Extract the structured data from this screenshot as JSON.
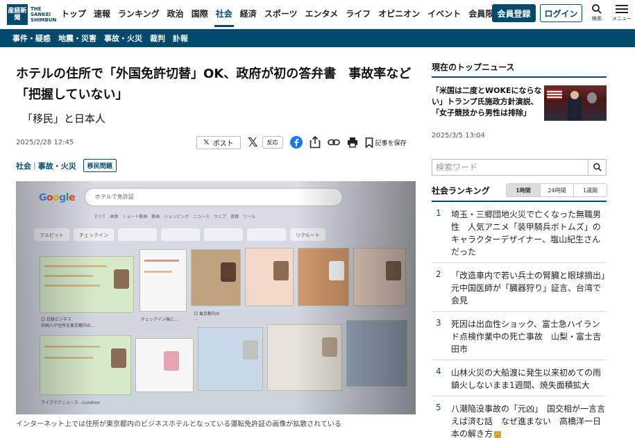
{
  "header": {
    "logo_mark": "産経新聞",
    "logo_text": [
      "THE",
      "SANKEI",
      "SHIMBUN"
    ],
    "nav": [
      "トップ",
      "速報",
      "ランキング",
      "政治",
      "国際",
      "社会",
      "経済",
      "スポーツ",
      "エンタメ",
      "ライフ",
      "オピニオン",
      "イベント",
      "会員限定記事"
    ],
    "active_nav": "社会",
    "register_label": "会員登録",
    "login_label": "ログイン",
    "search_label": "検索",
    "menu_label": "メニュー"
  },
  "subnav": [
    "事件・疑惑",
    "地震・災害",
    "事故・火災",
    "裁判",
    "訃報"
  ],
  "article": {
    "title": "ホテルの住所で「外国免許切替」OK、政府が初の答弁書　事故率など「把握していない」",
    "subtitle": "「移民」と日本人",
    "date": "2025/2/28 12:45",
    "share": {
      "post_label": "ポスト",
      "react_label": "反応",
      "save_label": "記事を保存"
    },
    "tags": {
      "category": "社会",
      "subcategory": "事故・火災",
      "badge": "移民問題"
    },
    "photo": {
      "google_logo": "Google",
      "search_text": "ホテルで免許証",
      "tabs": "すべて　画像　ショート動画　動画　ショッピング　ニュース　ウェブ　書籍　ツール",
      "chips": [
        "フルビット",
        "チェックイン",
        "",
        "",
        "",
        "",
        "リクルート"
      ],
      "captions": [
        "口 日経ビジネス\n中国人が住所を東京都内の...",
        "チェックイン後に...",
        "口 東京都内の\n...",
        "ライブドアニュース - Livedoor"
      ],
      "caption": "インターネット上では住所が東京都内のビジネスホテルとなっている運転免許証の画像が拡散されている"
    }
  },
  "sidebar": {
    "top_news_heading": "現在のトップニュース",
    "top_news_title": "「米国は二度とWOKEにならない」トランプ氏施政方針演説、「女子競技から男性は排除」",
    "top_news_date": "2025/3/5 13:04",
    "search_placeholder": "検索ワード",
    "ranking_heading": "社会ランキング",
    "ranking_tabs": [
      "1時間",
      "24時間",
      "1週間"
    ],
    "ranking_active": "1時間",
    "ranking": [
      {
        "no": "1",
        "text": "埼玉・三郷団地火災で亡くなった無職男性　人気アニメ「装甲騎兵ボトムズ」のキャラクターデザイナー、塩山紀生さんだった",
        "locked": false
      },
      {
        "no": "2",
        "text": "「改造車内で若い兵士の腎臓と眼球摘出」　元中国医師が「臓器狩り」証言、台湾で会見",
        "locked": false
      },
      {
        "no": "3",
        "text": "死因は出血性ショック、富士急ハイランド点検作業中の死亡事故　山梨・富士吉田市",
        "locked": false
      },
      {
        "no": "4",
        "text": "山林火災の大船渡に発生以来初めての雨　鎮火しないまま1週間、焼失面積拡大",
        "locked": false
      },
      {
        "no": "5",
        "text": "八潮陥没事故の「元凶」　国交相が一言言えば済む話　なぜ進まない　高橋洋一日本の解き方",
        "locked": true
      }
    ]
  },
  "colors": {
    "brand": "#004a6e",
    "lock": "#e0a520"
  }
}
